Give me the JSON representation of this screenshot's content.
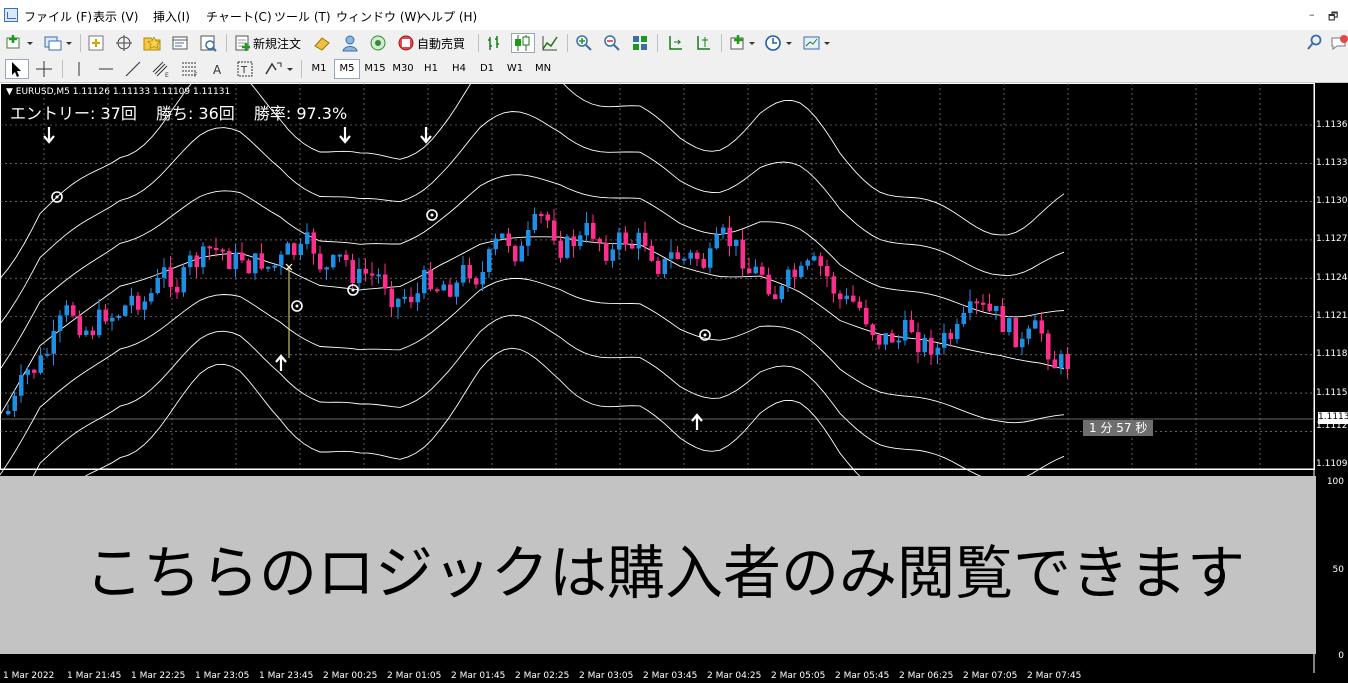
{
  "menu": {
    "items": [
      {
        "label": "ファイル (F)",
        "name": "menu-file"
      },
      {
        "label": "表示 (V)",
        "name": "menu-view"
      },
      {
        "label": "挿入(I)",
        "name": "menu-insert"
      },
      {
        "label": "チャート(C)",
        "name": "menu-chart"
      },
      {
        "label": "ツール (T)",
        "name": "menu-tools"
      },
      {
        "label": "ウィンドウ (W)",
        "name": "menu-window"
      },
      {
        "label": "ヘルプ (H)",
        "name": "menu-help"
      }
    ],
    "minimize": "–",
    "restore": "🗗"
  },
  "toolbar": {
    "new_order_label": "新規注文",
    "auto_trade_label": "自動売買",
    "timeframes": [
      "M1",
      "M5",
      "M15",
      "M30",
      "H1",
      "H4",
      "D1",
      "W1",
      "MN"
    ],
    "active_timeframe": "M5"
  },
  "chart": {
    "symbol_info": "▼ EURUSD,M5  1.11126 1.11133 1.11109 1.11131",
    "entry": "エントリー: 37回",
    "wins": "勝ち: 36回",
    "win_rate": "勝率: 97.3%",
    "price_axis": [
      "1.1136",
      "1.1133",
      "1.1130",
      "1.1127",
      "1.1124",
      "1.1121",
      "1.1118",
      "1.1115",
      "1.1112",
      "1.1109"
    ],
    "current_price": "1.1113",
    "timer": "1 分 57 秒",
    "sub_axis": {
      "top": "100",
      "mid": "50",
      "bottom": "0"
    },
    "time_axis": [
      "1 Mar 2022",
      "1 Mar 21:45",
      "1 Mar 22:25",
      "1 Mar 23:05",
      "1 Mar 23:45",
      "2 Mar 00:25",
      "2 Mar 01:05",
      "2 Mar 01:45",
      "2 Mar 02:25",
      "2 Mar 03:05",
      "2 Mar 03:45",
      "2 Mar 04:25",
      "2 Mar 05:05",
      "2 Mar 05:45",
      "2 Mar 06:25",
      "2 Mar 07:05",
      "2 Mar 07:45"
    ],
    "colors": {
      "bull": "#1e8fe6",
      "bear": "#ff2d8c",
      "band": "#ffffff",
      "grid": "#a0a0a0",
      "background": "#000000"
    }
  },
  "overlay": {
    "text": "こちらのロジックは購入者のみ閲覧できます"
  }
}
